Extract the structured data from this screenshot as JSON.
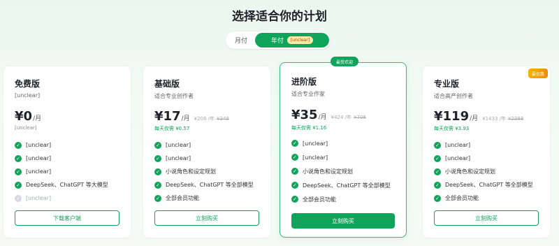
{
  "page": {
    "title": "选择适合你的计划"
  },
  "billing_toggle": {
    "monthly": "月付",
    "yearly": "年付",
    "yearly_badge": "[unclear]"
  },
  "plans": [
    {
      "name": "免费版",
      "desc": "[unclear]",
      "price": "¥0",
      "per": "/月",
      "orig_per_year": "",
      "orig_strike": "",
      "note": "[unclear]",
      "features": [
        {
          "text": "[unclear]",
          "enabled": true
        },
        {
          "text": "[unclear]",
          "enabled": true
        },
        {
          "text": "[unclear]",
          "enabled": true
        },
        {
          "text": "DeepSeek、ChatGPT 等大模型",
          "enabled": true
        },
        {
          "text": "[unclear]",
          "enabled": false
        }
      ],
      "button": "下载客户端"
    },
    {
      "name": "基础版",
      "desc": "适合专业创作者",
      "price": "¥17",
      "per": "/月",
      "orig_per_year": "¥208 /年",
      "orig_strike": "¥348",
      "note": "每天仅需 ¥0.57",
      "features": [
        {
          "text": "[unclear]",
          "enabled": true
        },
        {
          "text": "[unclear]",
          "enabled": true
        },
        {
          "text": "小说角色和设定规划",
          "enabled": true
        },
        {
          "text": "DeepSeek、ChatGPT 等全部模型",
          "enabled": true
        },
        {
          "text": "全部会员功能",
          "enabled": true
        }
      ],
      "button": "立刻购买"
    },
    {
      "name": "进阶版",
      "desc": "适合专业作家",
      "price": "¥35",
      "per": "/月",
      "orig_per_year": "¥424 /年",
      "orig_strike": "¥708",
      "note": "每天仅需 ¥1.16",
      "tag": "最受欢迎",
      "features": [
        {
          "text": "[unclear]",
          "enabled": true
        },
        {
          "text": "[unclear]",
          "enabled": true
        },
        {
          "text": "小说角色和设定规划",
          "enabled": true
        },
        {
          "text": "DeepSeek、ChatGPT 等全部模型",
          "enabled": true
        },
        {
          "text": "全部会员功能",
          "enabled": true
        }
      ],
      "button": "立刻购买"
    },
    {
      "name": "专业版",
      "desc": "适合高产创作者",
      "price": "¥119",
      "per": "/月",
      "orig_per_year": "¥1433 /年",
      "orig_strike": "¥2388",
      "note": "每天仅需 ¥3.93",
      "tag": "最优惠",
      "features": [
        {
          "text": "[unclear]",
          "enabled": true
        },
        {
          "text": "[unclear]",
          "enabled": true
        },
        {
          "text": "小说角色和设定规划",
          "enabled": true
        },
        {
          "text": "DeepSeek、ChatGPT 等全部模型",
          "enabled": true
        },
        {
          "text": "全部会员功能",
          "enabled": true
        }
      ],
      "button": "立刻购买"
    }
  ],
  "colors": {
    "accent": "#10a35a",
    "best_tag": "#f6b20c"
  }
}
